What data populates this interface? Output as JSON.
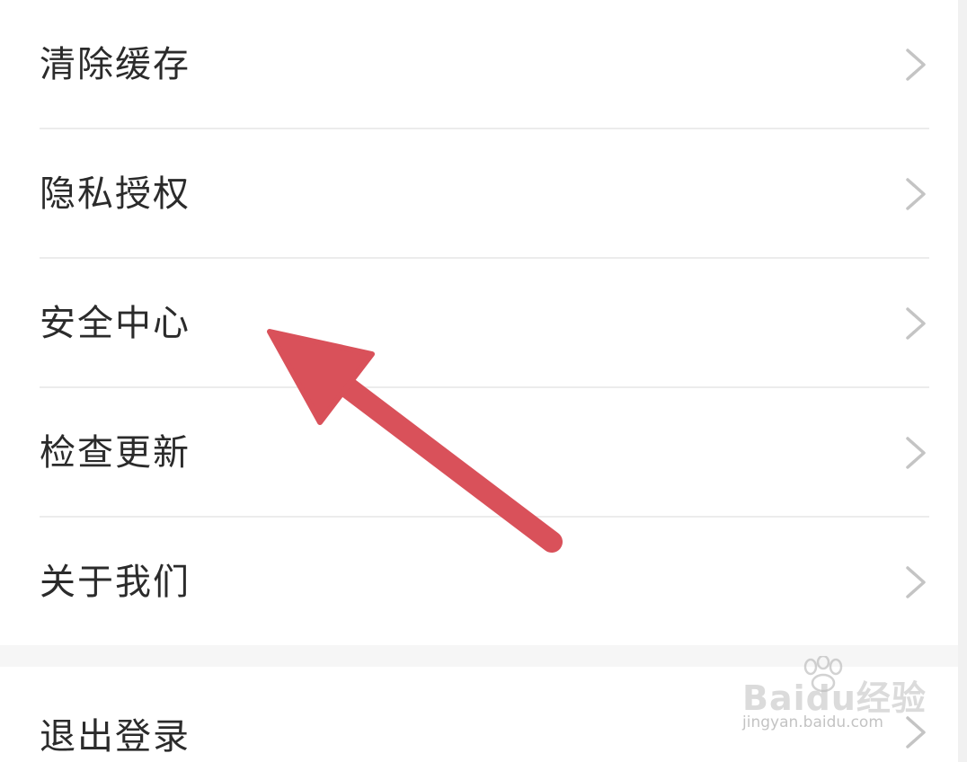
{
  "settings_menu": {
    "items": [
      {
        "label": "清除缓存",
        "chevron_icon": "chevron-right-icon"
      },
      {
        "label": "隐私授权",
        "chevron_icon": "chevron-right-icon"
      },
      {
        "label": "安全中心",
        "chevron_icon": "chevron-right-icon"
      },
      {
        "label": "检查更新",
        "chevron_icon": "chevron-right-icon"
      },
      {
        "label": "关于我们",
        "chevron_icon": "chevron-right-icon"
      }
    ],
    "logout": {
      "label": "退出登录",
      "chevron_icon": "chevron-right-icon"
    }
  },
  "annotation": {
    "icon": "arrow-icon",
    "color": "#d9515a",
    "points_to": "安全中心"
  },
  "watermark": {
    "brand_text": "Baidu经验",
    "url": "jingyan.baidu.com"
  },
  "colors": {
    "text": "#2b2b2b",
    "chevron": "#c4c4c4",
    "divider": "#ececec",
    "group_gap": "#f6f6f6",
    "arrow": "#d9515a"
  }
}
